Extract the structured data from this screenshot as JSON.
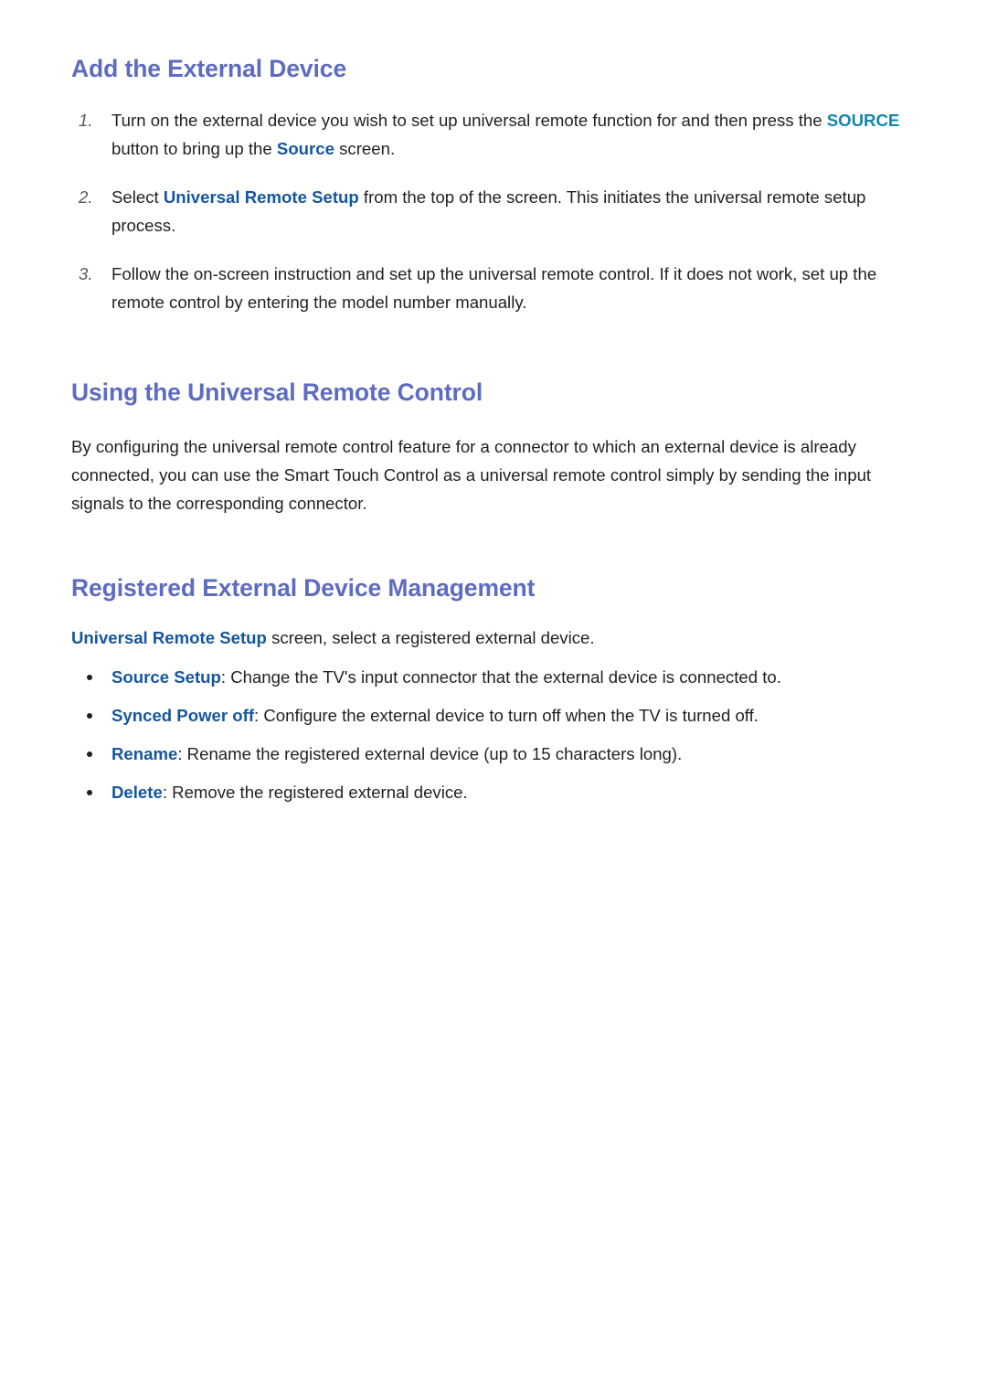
{
  "page": {
    "background_color": "#ffffff",
    "heading_color": "#5d6cc0",
    "body_color": "#231f20",
    "keyword_teal_color": "#1387a8",
    "keyword_blue_color": "#15569e"
  },
  "sections": {
    "add_device": {
      "heading": "Add the External Device",
      "steps": [
        {
          "number": "1.",
          "part1": "Turn on the external device you wish to set up universal remote function for and then press the ",
          "kw_teal": "SOURCE",
          "part2": " button to bring up the ",
          "kw_blue": "Source",
          "part3": " screen."
        },
        {
          "number": "2.",
          "part1": "Select ",
          "kw_blue": "Universal Remote Setup",
          "part2": " from the top of the screen. This initiates the universal remote setup process."
        },
        {
          "number": "3.",
          "part1": "Follow the on-screen instruction and set up the universal remote control. If it does not work, set up the remote control by entering the model number manually."
        }
      ]
    },
    "using_remote": {
      "heading": "Using the Universal Remote Control",
      "paragraph": "By configuring the universal remote control feature for a connector to which an external device is already connected, you can use the Smart Touch Control as a universal remote control simply by sending the input signals to the corresponding connector."
    },
    "registered_management": {
      "heading": "Registered External Device Management",
      "lead": {
        "kw_blue": "Universal Remote Setup",
        "rest": " screen, select a registered external device."
      },
      "bullets": [
        {
          "term": "Source Setup",
          "description": ": Change the TV's input connector that the external device is connected to."
        },
        {
          "term": "Synced Power off",
          "description": ": Configure the external device to turn off when the TV is turned off."
        },
        {
          "term": "Rename",
          "description": ": Rename the registered external device (up to 15 characters long)."
        },
        {
          "term": "Delete",
          "description": ": Remove the registered external device."
        }
      ]
    }
  }
}
